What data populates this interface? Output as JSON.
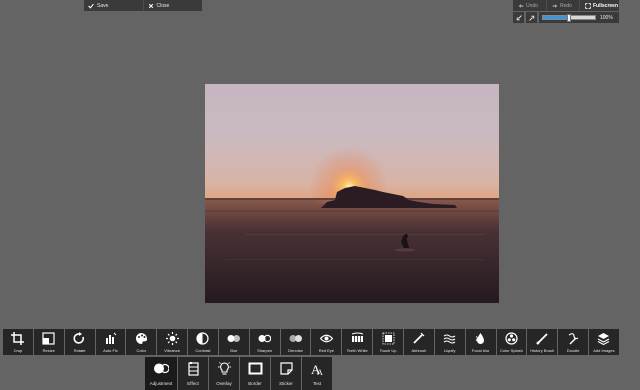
{
  "top_bar": {
    "save_label": "Save",
    "close_label": "Close"
  },
  "history": {
    "undo_label": "Undo",
    "redo_label": "Redo",
    "fullscreen_label": "Fullscreen"
  },
  "zoom": {
    "value_label": "100%",
    "level": 0.5,
    "accent_color": "#3d94d6"
  },
  "photo": {
    "description_icon": "sunset-photo"
  },
  "tools": [
    {
      "label": "Crop",
      "icon": "crop-icon"
    },
    {
      "label": "Resize",
      "icon": "resize-icon"
    },
    {
      "label": "Rotate",
      "icon": "rotate-icon"
    },
    {
      "label": "Auto Fix",
      "icon": "auto-fix-icon"
    },
    {
      "label": "Color",
      "icon": "palette-icon"
    },
    {
      "label": "Vibrance",
      "icon": "sun-icon"
    },
    {
      "label": "Contrast",
      "icon": "contrast-icon"
    },
    {
      "label": "Blur",
      "icon": "blur-icon"
    },
    {
      "label": "Sharpen",
      "icon": "sharpen-icon"
    },
    {
      "label": "Denoise",
      "icon": "denoise-icon"
    },
    {
      "label": "Red Eye",
      "icon": "eye-icon"
    },
    {
      "label": "Teeth White",
      "icon": "teeth-icon"
    },
    {
      "label": "Touch Up",
      "icon": "touch-up-icon"
    },
    {
      "label": "Airbrush",
      "icon": "airbrush-icon"
    },
    {
      "label": "Liquify",
      "icon": "liquify-icon"
    },
    {
      "label": "Focal blur",
      "icon": "focal-blur-icon"
    },
    {
      "label": "Color Splash",
      "icon": "color-splash-icon"
    },
    {
      "label": "History Brush",
      "icon": "history-brush-icon"
    },
    {
      "label": "Doodle",
      "icon": "doodle-icon"
    },
    {
      "label": "Add Images",
      "icon": "layers-icon"
    }
  ],
  "categories": [
    {
      "label": "Adjustment",
      "icon": "adjustment-icon",
      "active": true
    },
    {
      "label": "Effect",
      "icon": "effect-icon",
      "active": false
    },
    {
      "label": "Overlay",
      "icon": "lightbulb-icon",
      "active": false
    },
    {
      "label": "Border",
      "icon": "border-icon",
      "active": false
    },
    {
      "label": "Sticker",
      "icon": "sticker-icon",
      "active": false
    },
    {
      "label": "Text",
      "icon": "text-icon",
      "active": false
    }
  ]
}
